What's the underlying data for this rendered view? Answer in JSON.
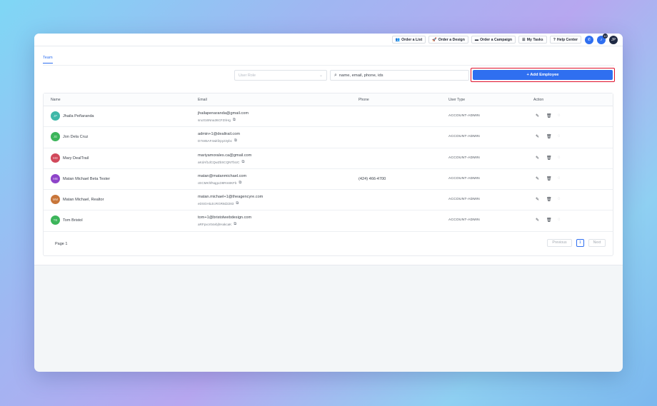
{
  "topbar": {
    "buttons": [
      {
        "icon": "users-icon",
        "glyph": "👥",
        "label": "Order a List"
      },
      {
        "icon": "rocket-icon",
        "glyph": "🚀",
        "label": "Order a Design"
      },
      {
        "icon": "campaign-icon",
        "glyph": "▬",
        "label": "Order a Campaign"
      },
      {
        "icon": "tasks-icon",
        "glyph": "☰",
        "label": "My Tasks"
      },
      {
        "icon": "help-icon",
        "glyph": "?",
        "label": "Help Center"
      }
    ],
    "notification_count": "12",
    "user_initials": "JP"
  },
  "tabs": {
    "team": "Team"
  },
  "filters": {
    "role_placeholder": "User Role",
    "search_placeholder": "name, email, phone, ids",
    "add_label": "+ Add Employee"
  },
  "table": {
    "headers": {
      "name": "Name",
      "email": "Email",
      "phone": "Phone",
      "user_type": "User Type",
      "action": "Action"
    },
    "rows": [
      {
        "initials": "JP",
        "color": "#3fb8a8",
        "name": "Jhaila Peñaranda",
        "email": "jhailapenaranda@gmail.com",
        "id": "sruzt16Nna36CFZriHg",
        "phone": "",
        "type": "ACCOUNT-ADMIN"
      },
      {
        "initials": "JD",
        "color": "#3cb55a",
        "name": "Jon Dela Cruz",
        "email": "admin+1@dealtrail.com",
        "id": "D7n85AF4wkfzpyz3ybc",
        "phone": "",
        "type": "ACCOUNT-ADMIN"
      },
      {
        "initials": "MD",
        "color": "#d1495b",
        "name": "Mary DealTrail",
        "email": "mariyamorales.ca@gmail.com",
        "id": "aKdAf1dCQwZbSCQNTbUC",
        "phone": "",
        "type": "ACCOUNT-ADMIN"
      },
      {
        "initials": "MB",
        "color": "#8e44c9",
        "name": "Matan Michael Beta Tester",
        "email": "matan@matanmichael.com",
        "id": "cECMKhfNqgLD8Rm8KFb",
        "phone": "(424) 466-4700",
        "type": "ACCOUNT-ADMIN"
      },
      {
        "initials": "MM",
        "color": "#c8763a",
        "name": "Matan Michael, Realtor",
        "email": "matan.michael+1@theagencyre.com",
        "id": "eDSGHiLEcRGR8d2283",
        "phone": "",
        "type": "ACCOUNT-ADMIN"
      },
      {
        "initials": "TB",
        "color": "#3cb55a",
        "name": "Tom Bristol",
        "email": "tom+1@bristolwebdesign.com",
        "id": "aRFpxcr04ebjhHakcaK",
        "phone": "",
        "type": "ACCOUNT-ADMIN"
      }
    ]
  },
  "pagination": {
    "page_label": "Page 1",
    "previous": "Previous",
    "current": "1",
    "next": "Next"
  }
}
